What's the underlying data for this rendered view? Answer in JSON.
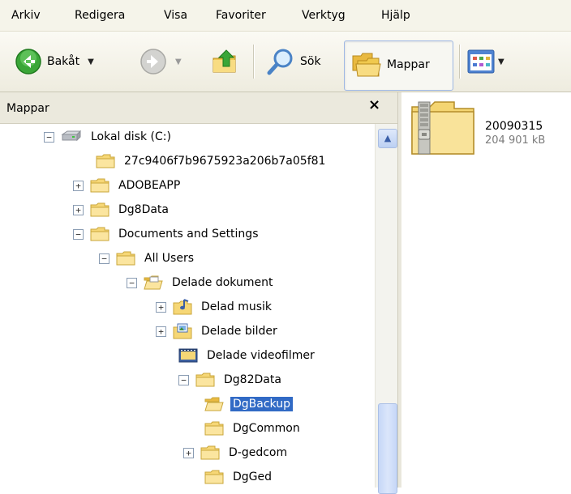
{
  "menu": [
    "Arkiv",
    "Redigera",
    "Visa",
    "Favoriter",
    "Verktyg",
    "Hjälp"
  ],
  "toolbar": {
    "back_label": "Bakåt",
    "search_label": "Sök",
    "folders_label": "Mappar"
  },
  "pane": {
    "title": "Mappar",
    "close_glyph": "×"
  },
  "tree": [
    {
      "label": "Lokal disk (C:)",
      "expander": "−",
      "icon": "drive-icon"
    },
    {
      "label": "27c9406f7b9675923a206b7a05f81",
      "expander": "",
      "icon": "folder-icon"
    },
    {
      "label": "ADOBEAPP",
      "expander": "+",
      "icon": "folder-icon"
    },
    {
      "label": "Dg8Data",
      "expander": "+",
      "icon": "folder-icon"
    },
    {
      "label": "Documents and Settings",
      "expander": "−",
      "icon": "folder-icon"
    },
    {
      "label": "All Users",
      "expander": "−",
      "icon": "folder-icon"
    },
    {
      "label": "Delade dokument",
      "expander": "−",
      "icon": "open-folder-icon"
    },
    {
      "label": "Delad musik",
      "expander": "+",
      "icon": "music-folder-icon"
    },
    {
      "label": "Delade bilder",
      "expander": "+",
      "icon": "pictures-folder-icon"
    },
    {
      "label": "Delade videofilmer",
      "expander": "",
      "icon": "video-folder-icon"
    },
    {
      "label": "Dg82Data",
      "expander": "−",
      "icon": "folder-icon"
    },
    {
      "label": "DgBackup",
      "expander": "",
      "icon": "open-folder-icon",
      "selected": true
    },
    {
      "label": "DgCommon",
      "expander": "",
      "icon": "folder-icon"
    },
    {
      "label": "D-gedcom",
      "expander": "+",
      "icon": "folder-icon"
    },
    {
      "label": "DgGed",
      "expander": "",
      "icon": "folder-icon"
    }
  ],
  "file": {
    "name": "20090315",
    "size": "204 901 kB",
    "icon": "zip-folder-icon"
  },
  "colors": {
    "selection": "#316ac5",
    "folder": "#f6d776",
    "menubar": "#f5f4ea"
  }
}
